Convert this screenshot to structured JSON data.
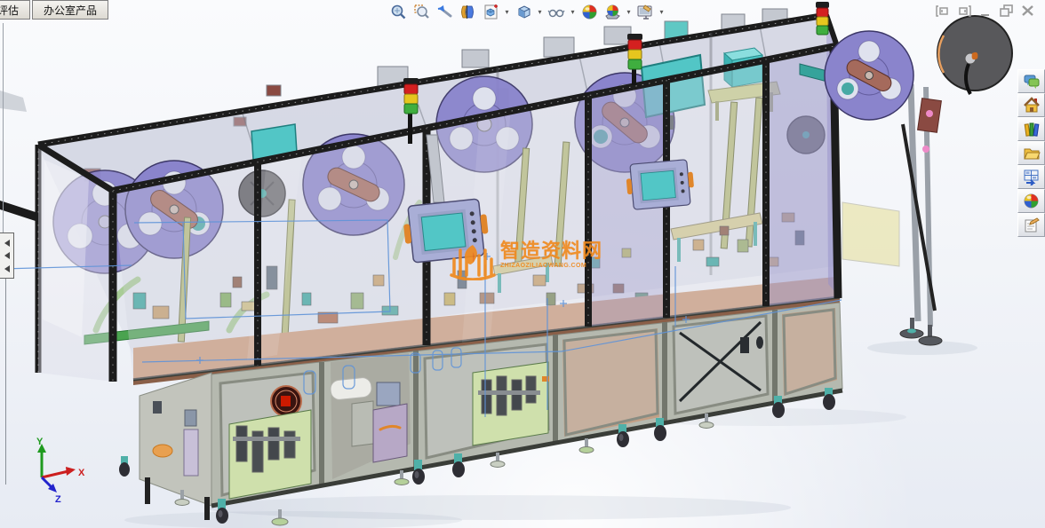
{
  "tabs": [
    {
      "label": "评估"
    },
    {
      "label": "办公室产品"
    }
  ],
  "heads_up_toolbar": {
    "items": [
      {
        "name": "Zoom to Fit",
        "icon": "magnifier-icon",
        "has_dropdown": false
      },
      {
        "name": "Zoom to Area",
        "icon": "magnifier-area-icon",
        "has_dropdown": false
      },
      {
        "name": "Previous View",
        "icon": "previous-view-icon",
        "has_dropdown": false
      },
      {
        "name": "Section View",
        "icon": "section-view-icon",
        "has_dropdown": false
      },
      {
        "name": "3D Drawing View",
        "icon": "drawing-view-icon",
        "has_dropdown": true
      },
      {
        "name": "View Orientation",
        "icon": "view-cube-icon",
        "has_dropdown": true
      },
      {
        "name": "Display Style",
        "icon": "glasses-icon",
        "has_dropdown": true
      },
      {
        "name": "Edit Appearance",
        "icon": "color-ball-icon",
        "has_dropdown": false
      },
      {
        "name": "Apply Scene",
        "icon": "scene-ball-icon",
        "has_dropdown": true
      },
      {
        "name": "View Settings",
        "icon": "monitor-settings-icon",
        "has_dropdown": true
      }
    ]
  },
  "window_controls": [
    {
      "name": "Dock Pane Left",
      "icon": "dock-left-icon"
    },
    {
      "name": "Dock Pane Right",
      "icon": "dock-right-icon"
    },
    {
      "name": "Minimize",
      "icon": "minimize-icon"
    },
    {
      "name": "Restore",
      "icon": "restore-icon"
    },
    {
      "name": "Close",
      "icon": "close-icon"
    }
  ],
  "task_pane": {
    "items": [
      {
        "name": "SOLIDWORKS Forum",
        "icon": "forum-bubbles-icon"
      },
      {
        "name": "SOLIDWORKS Resources",
        "icon": "home-icon"
      },
      {
        "name": "Design Library",
        "icon": "books-icon"
      },
      {
        "name": "File Explorer",
        "icon": "folder-icon"
      },
      {
        "name": "View Palette",
        "icon": "view-palette-icon"
      },
      {
        "name": "Appearances, Scenes, and Decals",
        "icon": "appearance-ball-icon"
      },
      {
        "name": "Custom Properties",
        "icon": "custom-properties-icon"
      }
    ]
  },
  "viewport": {
    "triad": {
      "x_label": "X",
      "y_label": "Y",
      "z_label": "Z"
    },
    "watermark": {
      "title": "智造资料网",
      "subtitle": "ZHIZAOZILIAOWANG.COM"
    },
    "model": "automated assembly line machine with reel feeders, enclosure frame and caster base"
  },
  "palette": {
    "watermarkOrange": "#f08a1e",
    "reelPurple": "#8a84cc",
    "reelEdge": "#3c3768",
    "armBrown": "#a56a5c",
    "frameBlack": "#1c1c1c",
    "deckTan": "#cf9e7d",
    "cabinetGray": "#b5b9af",
    "oliveSlat": "#b9bf7c",
    "tealAccent": "#36a39b",
    "screenTeal": "#52c6c6",
    "stackRed": "#d42020",
    "stackYellow": "#e6c61e",
    "stackGreen": "#3fae3f",
    "sketchBlue": "#5f93d8",
    "hmiLavender": "#a9aed6",
    "greenPanel": "#cfe0ac",
    "wheelTeal": "#4fb0a8",
    "darkDisc": "#58585b",
    "orangeHandle": "#e0862a",
    "triadX": "#cc1f1f",
    "triadY": "#1f9a1f",
    "triadZ": "#2323cc"
  }
}
